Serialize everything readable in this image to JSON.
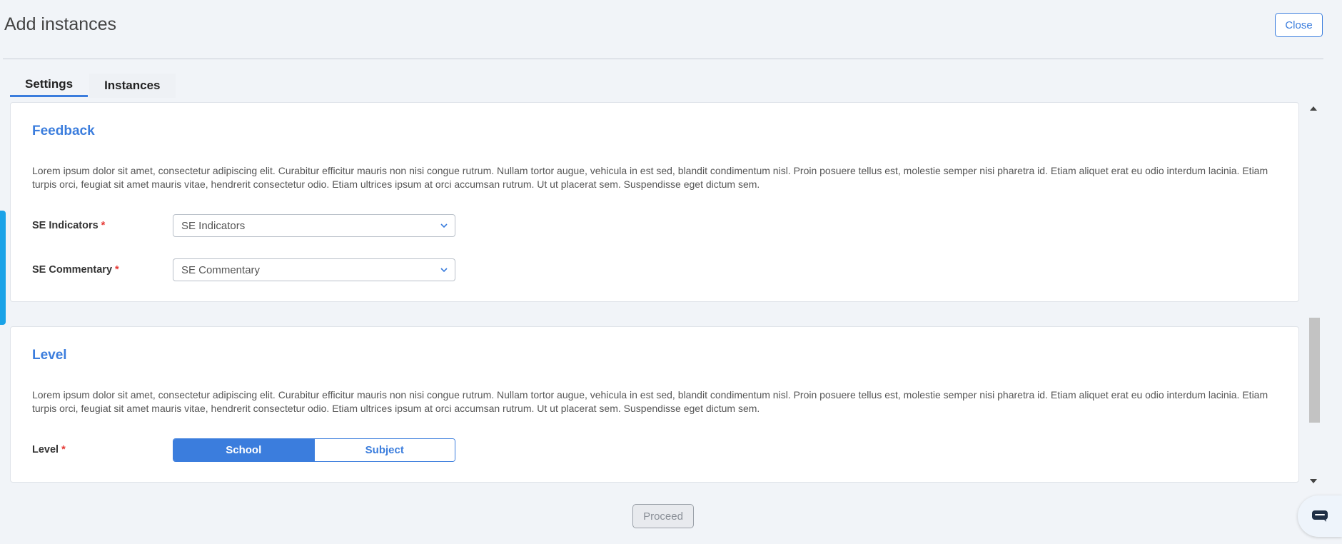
{
  "header": {
    "title": "Add instances",
    "close_label": "Close"
  },
  "tabs": [
    {
      "label": "Settings",
      "active": true
    },
    {
      "label": "Instances",
      "active": false
    }
  ],
  "feedback": {
    "title": "Feedback",
    "description": "Lorem ipsum dolor sit amet, consectetur adipiscing elit. Curabitur efficitur mauris non nisi congue rutrum. Nullam tortor augue, vehicula in est sed, blandit condimentum nisl. Proin posuere tellus est, molestie semper nisi pharetra id. Etiam aliquet erat eu odio interdum lacinia. Etiam turpis orci, feugiat sit amet mauris vitae, hendrerit consectetur odio. Etiam ultrices ipsum at orci accumsan rutrum. Ut ut placerat sem. Suspendisse eget dictum sem.",
    "fields": [
      {
        "label": "SE Indicators",
        "required_mark": "*",
        "value": "SE Indicators",
        "icon": "chevron-down-icon"
      },
      {
        "label": "SE Commentary",
        "required_mark": "*",
        "value": "SE Commentary",
        "icon": "chevron-down-icon"
      }
    ]
  },
  "level": {
    "title": "Level",
    "description": "Lorem ipsum dolor sit amet, consectetur adipiscing elit. Curabitur efficitur mauris non nisi congue rutrum. Nullam tortor augue, vehicula in est sed, blandit condimentum nisl. Proin posuere tellus est, molestie semper nisi pharetra id. Etiam aliquet erat eu odio interdum lacinia. Etiam turpis orci, feugiat sit amet mauris vitae, hendrerit consectetur odio. Etiam ultrices ipsum at orci accumsan rutrum. Ut ut placerat sem. Suspendisse eget dictum sem.",
    "field_label": "Level",
    "required_mark": "*",
    "options": [
      {
        "label": "School",
        "selected": true
      },
      {
        "label": "Subject",
        "selected": false
      }
    ]
  },
  "footer": {
    "proceed_label": "Proceed"
  },
  "chat": {
    "icon": "chat-icon"
  },
  "colors": {
    "accent": "#3b7ddd",
    "required": "#e53935",
    "background": "#f1f4f8",
    "side_accent": "#1aa3e8"
  }
}
